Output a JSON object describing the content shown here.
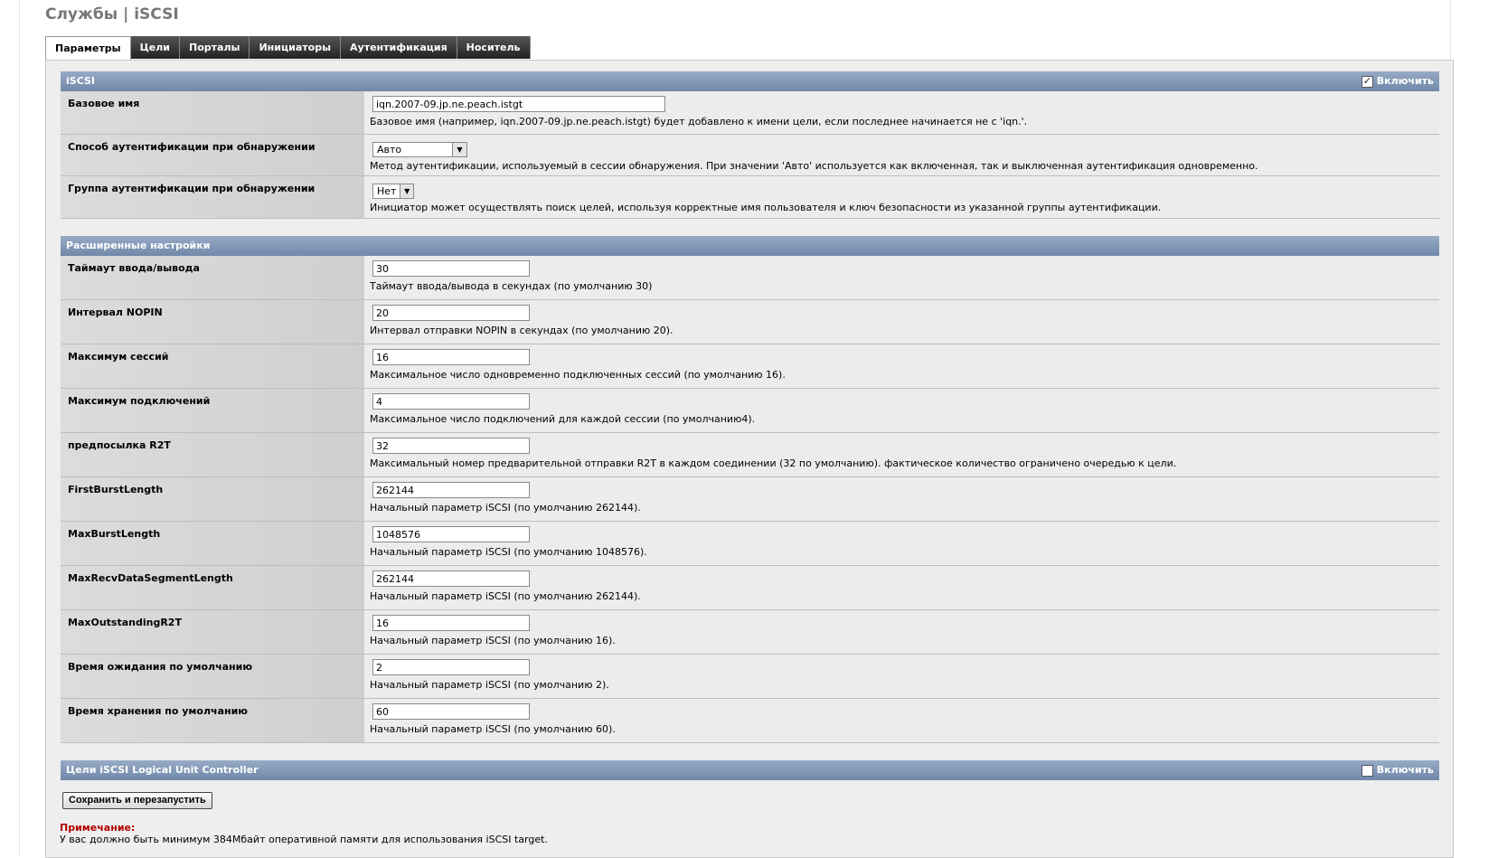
{
  "page_title": "Службы | iSCSI",
  "tabs": [
    {
      "label": "Параметры",
      "active": true
    },
    {
      "label": "Цели"
    },
    {
      "label": "Порталы"
    },
    {
      "label": "Инициаторы"
    },
    {
      "label": "Аутентификация"
    },
    {
      "label": "Носитель"
    }
  ],
  "iscsi_section": {
    "title": "iSCSI",
    "enable_label": "Включить",
    "enabled": true,
    "rows": [
      {
        "label": "Базовое имя",
        "value": "iqn.2007-09.jp.ne.peach.istgt",
        "hint": "Базовое имя (например, iqn.2007-09.jp.ne.peach.istgt) будет добавлено к имени цели, если последнее начинается не с 'iqn.'."
      },
      {
        "label": "Способ аутентификации при обнаружении",
        "value": "Авто",
        "hint": "Метод аутентификации, используемый в сессии обнаружения. При значении 'Авто' используется как включенная, так и выключенная аутентификация одновременно."
      },
      {
        "label": "Группа аутентификации при обнаружении",
        "value": "Нет",
        "hint": "Инициатор может осуществлять поиск целей, используя корректные имя пользователя и ключ безопасности из указанной группы аутентификации."
      }
    ]
  },
  "advanced_section": {
    "title": "Расширенные настройки",
    "rows": [
      {
        "label": "Таймаут ввода/вывода",
        "value": "30",
        "hint": "Таймаут ввода/вывода в секундах (по умолчанию 30)"
      },
      {
        "label": "Интервал NOPIN",
        "value": "20",
        "hint": "Интервал отправки NOPIN в секундах (по умолчанию 20)."
      },
      {
        "label": "Максимум сессий",
        "value": "16",
        "hint": "Максимальное число одновременно подключенных сессий (по умолчанию 16)."
      },
      {
        "label": "Максимум подключений",
        "value": "4",
        "hint": "Максимальное число подключений для каждой сессии (по умолчанию4)."
      },
      {
        "label": "предпосылка R2T",
        "value": "32",
        "hint": "Максимальный номер предварительной отправки R2T в каждом соединении (32 по умолчанию). фактическое количество ограничено очередью к цели."
      },
      {
        "label": "FirstBurstLength",
        "value": "262144",
        "hint": "Начальный параметр iSCSI (по умолчанию 262144)."
      },
      {
        "label": "MaxBurstLength",
        "value": "1048576",
        "hint": "Начальный параметр iSCSI (по умолчанию 1048576)."
      },
      {
        "label": "MaxRecvDataSegmentLength",
        "value": "262144",
        "hint": "Начальный параметр iSCSI (по умолчанию 262144)."
      },
      {
        "label": "MaxOutstandingR2T",
        "value": "16",
        "hint": "Начальный параметр iSCSI (по умолчанию 16)."
      },
      {
        "label": "Время ожидания по умолчанию",
        "value": "2",
        "hint": "Начальный параметр iSCSI (по умолчанию 2)."
      },
      {
        "label": "Время хранения по умолчанию",
        "value": "60",
        "hint": "Начальный параметр iSCSI (по умолчанию 60)."
      }
    ]
  },
  "luc_section": {
    "title": "Цели iSCSI Logical Unit Controller",
    "enable_label": "Включить",
    "enabled": false
  },
  "save_button": "Сохранить и перезапустить",
  "note": {
    "title": "Примечание:",
    "text": "У вас должно быть минимум 384Мбайт оперативной памяти для использования iSCSI target."
  },
  "colors": {
    "section_header": "#7f95b4",
    "note_title": "#b00000",
    "tab_bg": "#3a3a3a"
  }
}
